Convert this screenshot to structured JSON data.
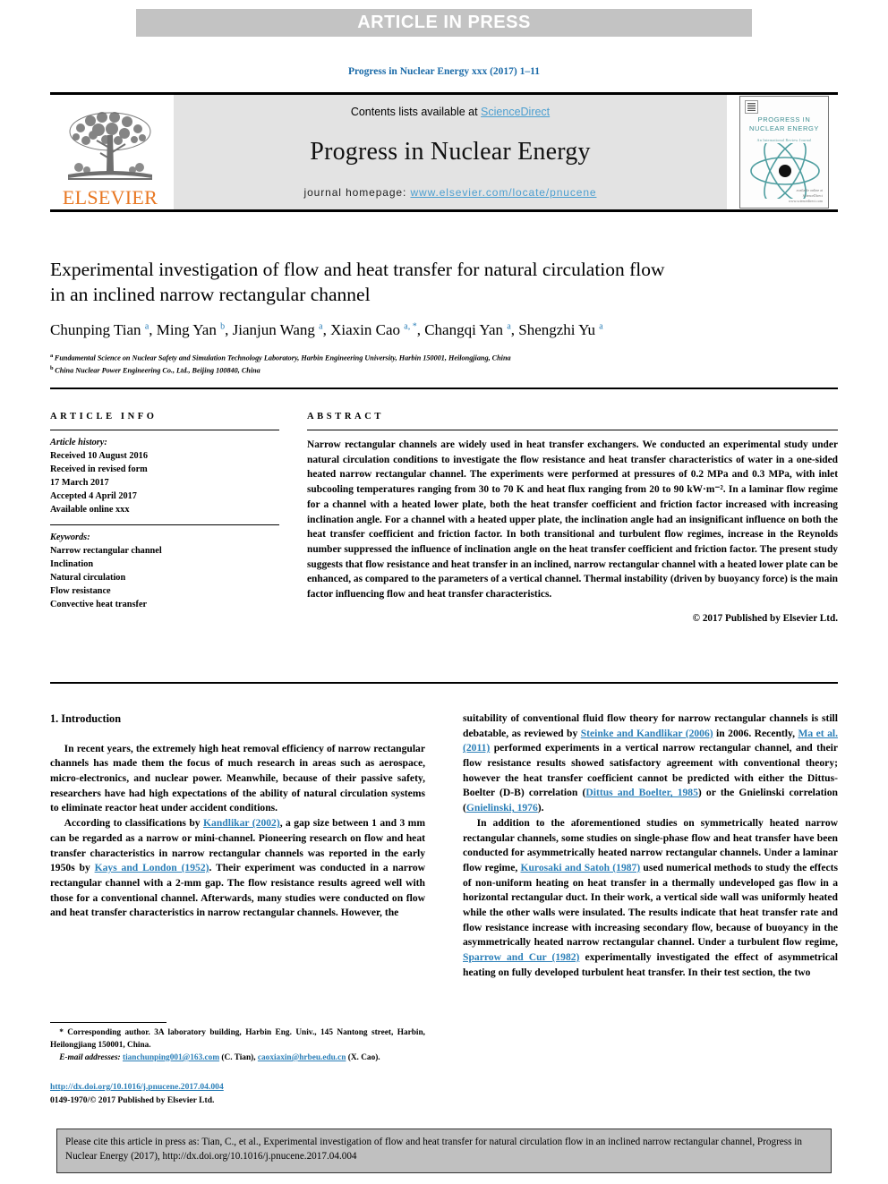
{
  "banner": {
    "label": "ARTICLE IN PRESS"
  },
  "running_head": "Progress in Nuclear Energy xxx (2017) 1–11",
  "masthead": {
    "publisher_name": "ELSEVIER",
    "contents_prefix": "Contents lists available at ",
    "contents_link": "ScienceDirect",
    "journal_name": "Progress in Nuclear Energy",
    "homepage_prefix": "journal homepage: ",
    "homepage_url": "www.elsevier.com/locate/pnucene",
    "cover": {
      "title_line1": "PROGRESS IN",
      "title_line2": "NUCLEAR ENERGY",
      "subtitle": "An International Review Journal",
      "footer_line1": "available online at",
      "footer_line2": "ScienceDirect",
      "footer_line3": "www.sciencedirect.com"
    }
  },
  "article": {
    "title": "Experimental investigation of flow and heat transfer for natural circulation flow in an inclined narrow rectangular channel",
    "authors": [
      {
        "name": "Chunping Tian",
        "marks": "a"
      },
      {
        "name": "Ming Yan",
        "marks": "b"
      },
      {
        "name": "Jianjun Wang",
        "marks": "a"
      },
      {
        "name": "Xiaxin Cao",
        "marks": "a, *"
      },
      {
        "name": "Changqi Yan",
        "marks": "a"
      },
      {
        "name": "Shengzhi Yu",
        "marks": "a"
      }
    ],
    "affiliations": [
      {
        "mark": "a",
        "text": "Fundamental Science on Nuclear Safety and Simulation Technology Laboratory, Harbin Engineering University, Harbin 150001, Heilongjiang, China"
      },
      {
        "mark": "b",
        "text": "China Nuclear Power Engineering Co., Ltd., Beijing 100840, China"
      }
    ]
  },
  "article_info": {
    "heading": "ARTICLE INFO",
    "history_label": "Article history:",
    "history": [
      "Received 10 August 2016",
      "Received in revised form",
      "17 March 2017",
      "Accepted 4 April 2017",
      "Available online xxx"
    ],
    "keywords_label": "Keywords:",
    "keywords": [
      "Narrow rectangular channel",
      "Inclination",
      "Natural circulation",
      "Flow resistance",
      "Convective heat transfer"
    ]
  },
  "abstract": {
    "heading": "ABSTRACT",
    "text": "Narrow rectangular channels are widely used in heat transfer exchangers. We conducted an experimental study under natural circulation conditions to investigate the flow resistance and heat transfer characteristics of water in a one-sided heated narrow rectangular channel. The experiments were performed at pressures of 0.2 MPa and 0.3 MPa, with inlet subcooling temperatures ranging from 30 to 70 K and heat flux ranging from 20 to 90 kW·m⁻². In a laminar flow regime for a channel with a heated lower plate, both the heat transfer coefficient and friction factor increased with increasing inclination angle. For a channel with a heated upper plate, the inclination angle had an insignificant influence on both the heat transfer coefficient and friction factor. In both transitional and turbulent flow regimes, increase in the Reynolds number suppressed the influence of inclination angle on the heat transfer coefficient and friction factor. The present study suggests that flow resistance and heat transfer in an inclined, narrow rectangular channel with a heated lower plate can be enhanced, as compared to the parameters of a vertical channel. Thermal instability (driven by buoyancy force) is the main factor influencing flow and heat transfer characteristics.",
    "copyright": "© 2017 Published by Elsevier Ltd."
  },
  "body": {
    "section_number_title": "1. Introduction",
    "left_paragraphs": [
      "In recent years, the extremely high heat removal efficiency of narrow rectangular channels has made them the focus of much research in areas such as aerospace, micro-electronics, and nuclear power. Meanwhile, because of their passive safety, researchers have had high expectations of the ability of natural circulation systems to eliminate reactor heat under accident conditions.",
      "According to classifications by |Kandlikar (2002)|, a gap size between 1 and 3 mm can be regarded as a narrow or mini-channel. Pioneering research on flow and heat transfer characteristics in narrow rectangular channels was reported in the early 1950s by |Kays and London (1952)|. Their experiment was conducted in a narrow rectangular channel with a 2-mm gap. The flow resistance results agreed well with those for a conventional channel. Afterwards, many studies were conducted on flow and heat transfer characteristics in narrow rectangular channels. However, the"
    ],
    "right_paragraphs": [
      "suitability of conventional fluid flow theory for narrow rectangular channels is still debatable, as reviewed by |Steinke and Kandlikar (2006)| in 2006. Recently, |Ma et al. (2011)| performed experiments in a vertical narrow rectangular channel, and their flow resistance results showed satisfactory agreement with conventional theory; however the heat transfer coefficient cannot be predicted with either the Dittus-Boelter (D-B) correlation (|Dittus and Boelter, 1985|) or the Gnielinski correlation (|Gnielinski, 1976|).",
      "In addition to the aforementioned studies on symmetrically heated narrow rectangular channels, some studies on single-phase flow and heat transfer have been conducted for asymmetrically heated narrow rectangular channels. Under a laminar flow regime, |Kurosaki and Satoh (1987)| used numerical methods to study the effects of non-uniform heating on heat transfer in a thermally undeveloped gas flow in a horizontal rectangular duct. In their work, a vertical side wall was uniformly heated while the other walls were insulated. The results indicate that heat transfer rate and flow resistance increase with increasing secondary flow, because of buoyancy in the asymmetrically heated narrow rectangular channel. Under a turbulent flow regime, |Sparrow and Cur (1982)| experimentally investigated the effect of asymmetrical heating on fully developed turbulent heat transfer. In their test section, the two"
    ],
    "no_indent_first_right": true
  },
  "footnotes": {
    "corresponding": "* Corresponding author. 3A laboratory building, Harbin Eng. Univ., 145 Nantong street, Harbin, Heilongjiang 150001, China.",
    "email_label": "E-mail addresses:",
    "emails": [
      {
        "address": "tianchunping001@163.com",
        "owner": "(C. Tian)"
      },
      {
        "address": "caoxiaxin@hrbeu.edu.cn",
        "owner": "(X. Cao)"
      }
    ],
    "doi": "http://dx.doi.org/10.1016/j.pnucene.2017.04.004",
    "issn_line": "0149-1970/© 2017 Published by Elsevier Ltd."
  },
  "citation_box": {
    "text": "Please cite this article in press as: Tian, C., et al., Experimental investigation of flow and heat transfer for natural circulation flow in an inclined narrow rectangular channel, Progress in Nuclear Energy (2017), http://dx.doi.org/10.1016/j.pnucene.2017.04.004"
  },
  "colors": {
    "link_blue": "#2b7fb8",
    "sciencedirect_blue": "#4c9fd0",
    "elsevier_orange": "#E87722",
    "banner_gray": "#c3c3c3",
    "masthead_gray": "#e3e3e3",
    "cite_box_gray": "#c0c0c0",
    "cover_teal": "#3f8f92"
  }
}
